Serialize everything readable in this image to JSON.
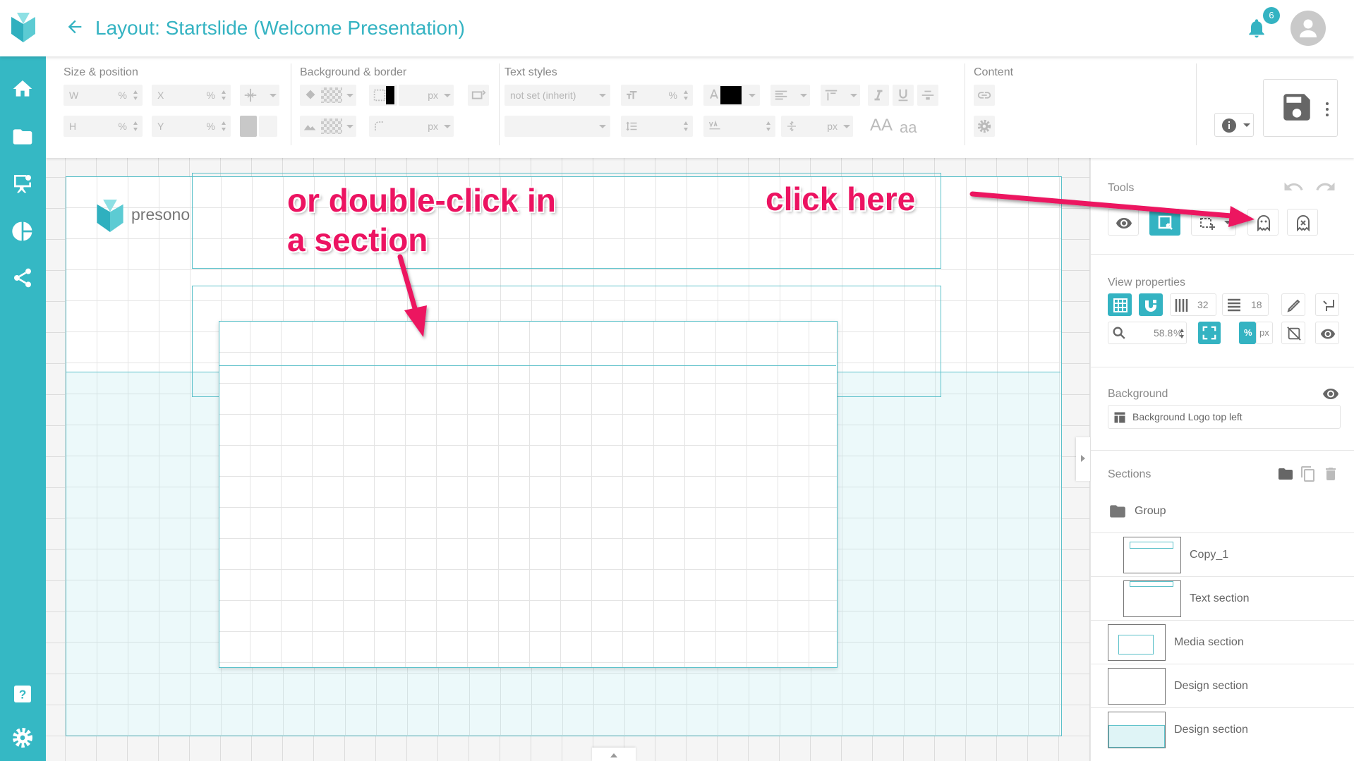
{
  "header": {
    "title": "Layout: Startslide (Welcome Presentation)",
    "notification_count": "6"
  },
  "toolbar": {
    "size_position": {
      "label": "Size & position",
      "w": "W",
      "x": "X",
      "h": "H",
      "y": "Y",
      "unit_percent": "%"
    },
    "background_border": {
      "label": "Background & border",
      "unit_px": "px"
    },
    "text_styles": {
      "label": "Text styles",
      "font_select": "not set (inherit)",
      "unit_percent": "%",
      "unit_px": "px",
      "size_up_label": "AA",
      "size_down_label": "aa",
      "text_color": "#000000"
    },
    "content": {
      "label": "Content"
    }
  },
  "canvas": {
    "logo_text": "presono",
    "annotation_left": [
      "or double-click in",
      "a section"
    ],
    "annotation_right": "click here",
    "annotation_color": "#ec1361"
  },
  "right_panel": {
    "tools_label": "Tools",
    "view_properties_label": "View properties",
    "columns_value": "32",
    "rows_value": "18",
    "zoom_value": "58.8",
    "zoom_unit": "%",
    "unit_percent": "%",
    "unit_px": "px",
    "background_label": "Background",
    "background_value": "Background Logo top left",
    "sections_label": "Sections",
    "sections": [
      {
        "label": "Group"
      },
      {
        "label": "Copy_1"
      },
      {
        "label": "Text section"
      },
      {
        "label": "Media section"
      },
      {
        "label": "Design section"
      },
      {
        "label": "Design section"
      }
    ]
  },
  "colors": {
    "accent": "#34b3c2",
    "sidebar": "#35b8c4",
    "annotation": "#ec1361"
  }
}
